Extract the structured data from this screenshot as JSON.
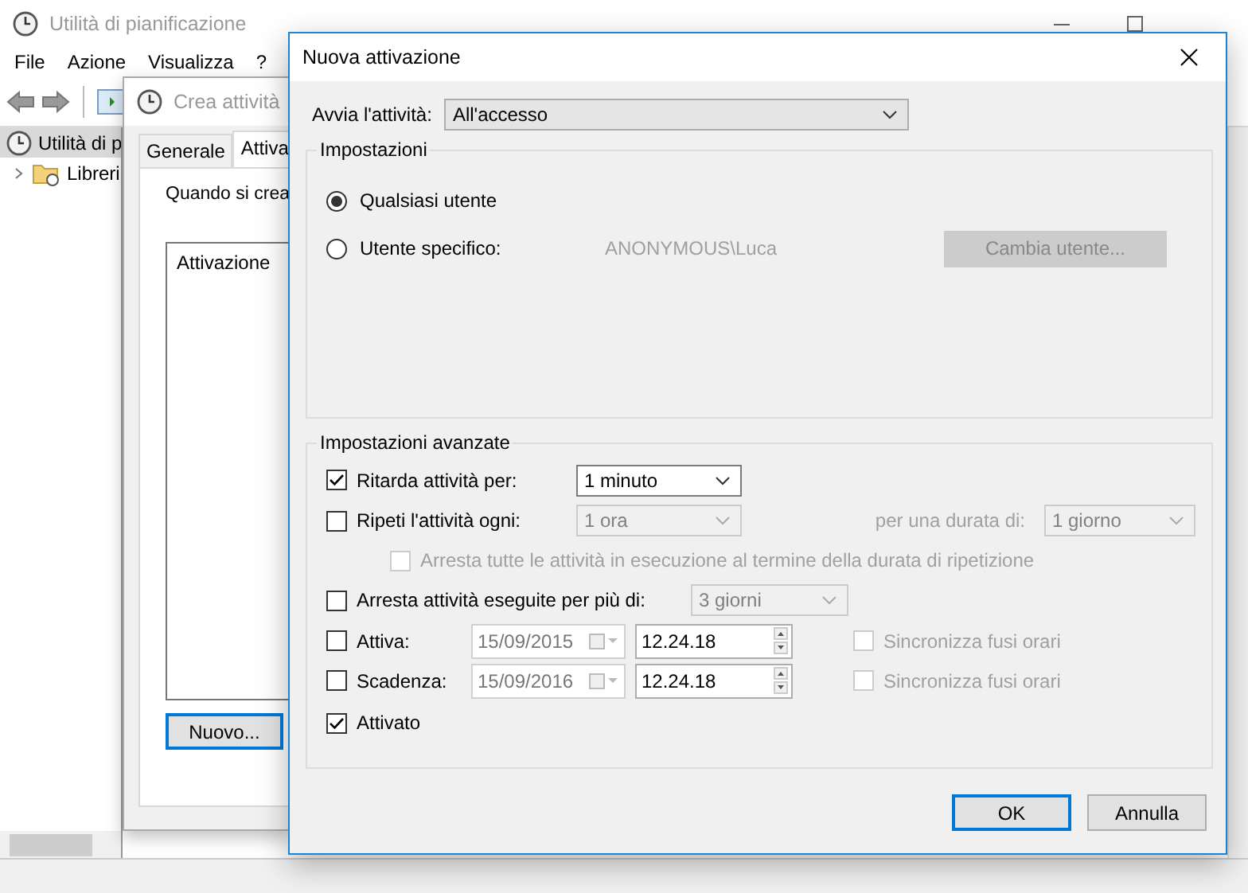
{
  "main_window": {
    "title": "Utilità di pianificazione",
    "menu": [
      "File",
      "Azione",
      "Visualizza",
      "?"
    ],
    "tree": [
      {
        "label": "Utilità di p",
        "selected": true,
        "children": [
          {
            "label": "Libreri",
            "selected": false,
            "expanded": false
          }
        ]
      }
    ]
  },
  "create_window": {
    "title": "Crea attività",
    "tabs": [
      {
        "label": "Generale",
        "selected": false
      },
      {
        "label": "Attiva",
        "selected": true
      }
    ],
    "intro": "Quando si crea",
    "list_column": "Attivazione",
    "new_button": "Nuovo..."
  },
  "dialog": {
    "title": "Nuova attivazione",
    "start": {
      "label": "Avvia l'attività:",
      "value": "All'accesso"
    },
    "settings": {
      "title": "Impostazioni",
      "users": [
        {
          "label": "Qualsiasi utente",
          "selected": true
        },
        {
          "label": "Utente specifico:",
          "selected": false
        }
      ],
      "account": "ANONYMOUS\\Luca",
      "change_user_button": "Cambia utente..."
    },
    "advanced": {
      "title": "Impostazioni avanzate",
      "delay": {
        "label": "Ritarda attività per:",
        "checked": true,
        "value": "1 minuto"
      },
      "repeat": {
        "label": "Ripeti l'attività ogni:",
        "checked": false,
        "value": "1 ora",
        "duration_label": "per una durata di:",
        "duration_value": "1 giorno"
      },
      "stop_all": {
        "label": "Arresta tutte le attività in esecuzione al termine della durata di ripetizione",
        "checked": false
      },
      "stop_long": {
        "label": "Arresta attività eseguite per più di:",
        "checked": false,
        "value": "3 giorni"
      },
      "schedule": [
        {
          "label": "Attiva:",
          "checked": false,
          "date": "15/09/2015",
          "time": "12.24.18",
          "sync_label": "Sincronizza fusi orari",
          "sync_checked": false
        },
        {
          "label": "Scadenza:",
          "checked": false,
          "date": "15/09/2016",
          "time": "12.24.18",
          "sync_label": "Sincronizza fusi orari",
          "sync_checked": false
        }
      ],
      "enabled": {
        "label": "Attivato",
        "checked": true
      }
    },
    "buttons": [
      {
        "label": "OK",
        "default": true
      },
      {
        "label": "Annulla",
        "default": false
      }
    ]
  }
}
